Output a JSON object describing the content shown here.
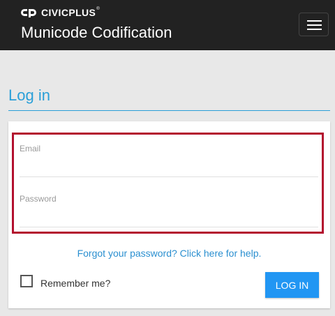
{
  "header": {
    "brand_name": "CIVICPLUS",
    "brand_trademark": "®",
    "app_title": "Municode Codification",
    "menu_icon": "hamburger-icon"
  },
  "login": {
    "heading": "Log in",
    "email_label": "Email",
    "email_value": "",
    "password_label": "Password",
    "password_value": "",
    "forgot_link": "Forgot your password? Click here for help.",
    "remember_label": "Remember me?",
    "remember_checked": false,
    "submit_label": "LOG IN"
  },
  "colors": {
    "topbar_bg": "#222222",
    "accent_blue": "#2a9fd8",
    "button_blue": "#2196f3",
    "highlight_red": "#b3102e",
    "page_bg": "#e8e8e8"
  }
}
